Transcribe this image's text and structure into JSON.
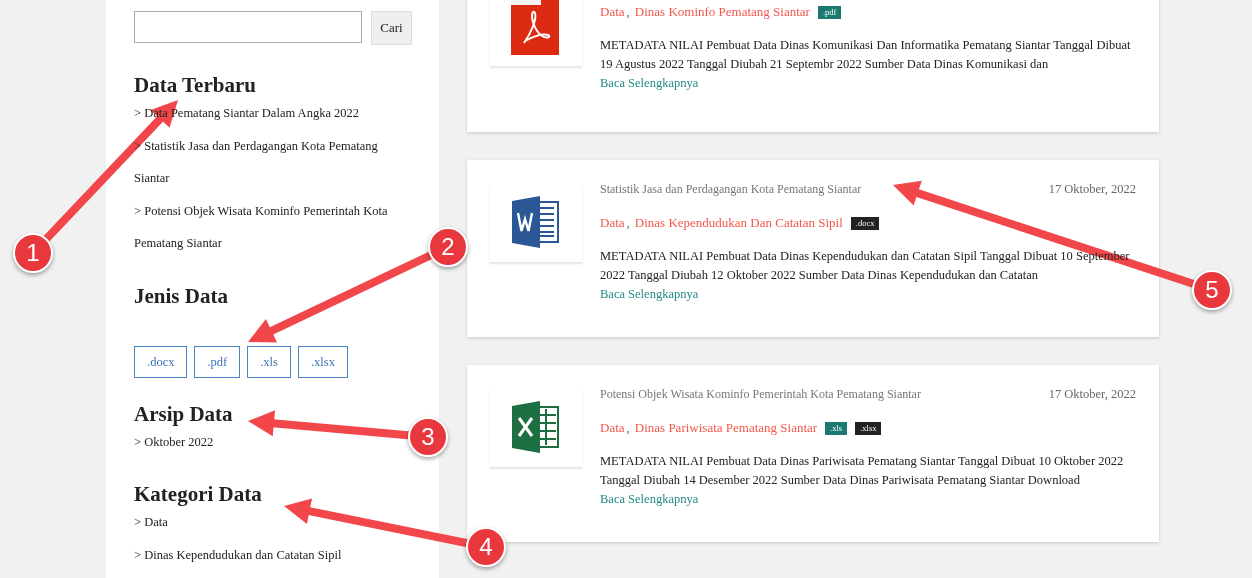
{
  "sidebar": {
    "search": {
      "button": "Cari"
    },
    "sections": [
      {
        "kind": "links",
        "title": "Data Terbaru",
        "items": [
          "> Data Pematang Siantar Dalam Angka 2022",
          "> Statistik Jasa dan Perdagangan Kota Pematang Siantar",
          "> Potensi Objek Wisata Kominfo Pemerintah Kota Pematang Siantar"
        ]
      },
      {
        "kind": "tags",
        "title": "Jenis Data",
        "items": [
          ".docx",
          ".pdf",
          ".xls",
          ".xlsx"
        ]
      },
      {
        "kind": "links",
        "title": "Arsip Data",
        "items": [
          "> Oktober 2022"
        ]
      },
      {
        "kind": "links",
        "title": "Kategori Data",
        "items": [
          "> Data",
          "> Dinas Kependudukan dan Catatan Sipil"
        ]
      }
    ]
  },
  "posts": [
    {
      "kind": "pdf",
      "separator": ",",
      "categories": [
        "Data",
        "Dinas Kominfo Pematang Siantar"
      ],
      "tags": [
        {
          "label": ".pdf",
          "color": "#1b7a6f"
        }
      ],
      "excerpt": "METADATA NILAI Pembuat Data Dinas Komunikasi Dan Informatika Pematang Siantar Tanggal Dibuat 19 Agustus 2022 Tanggal Diubah 21 Septembr 2022 Sumber Data Dinas Komunikasi dan",
      "more": "Baca Selengkapnya"
    },
    {
      "kind": "word",
      "separator": ",",
      "title": "Statistik Jasa dan Perdagangan Kota Pematang Siantar",
      "date": "17 Oktober, 2022",
      "categories": [
        "Data",
        "Dinas Kependudukan Dan Catatan Sipil"
      ],
      "tags": [
        {
          "label": ".docx",
          "color": "#222222"
        }
      ],
      "excerpt": "METADATA NILAI Pembuat Data Dinas Kependudukan dan Catatan Sipil Tanggal Dibuat 10 September 2022 Tanggal Diubah 12 Oktober 2022 Sumber Data Dinas Kependudukan dan Catatan",
      "more": "Baca Selengkapnya"
    },
    {
      "kind": "excel",
      "separator": ",",
      "title": "Potensi Objek Wisata Kominfo Pemerintah Kota Pematang Siantar",
      "date": "17 Oktober, 2022",
      "categories": [
        "Data",
        "Dinas Pariwisata Pematang Siantar"
      ],
      "tags": [
        {
          "label": ".xls",
          "color": "#1b7a6f"
        },
        {
          "label": ".xlsx",
          "color": "#222222"
        }
      ],
      "excerpt": "METADATA NILAI Pembuat Data Dinas Pariwisata Pematang Siantar Tanggal Dibuat 10 Oktober 2022 Tanggal Diubah 14 Desember 2022 Sumber Data Dinas Pariwisata Pematang Siantar Download",
      "more": "Baca Selengkapnya"
    }
  ],
  "annotations": [
    {
      "label": "1"
    },
    {
      "label": "2"
    },
    {
      "label": "3"
    },
    {
      "label": "4"
    },
    {
      "label": "5"
    }
  ]
}
